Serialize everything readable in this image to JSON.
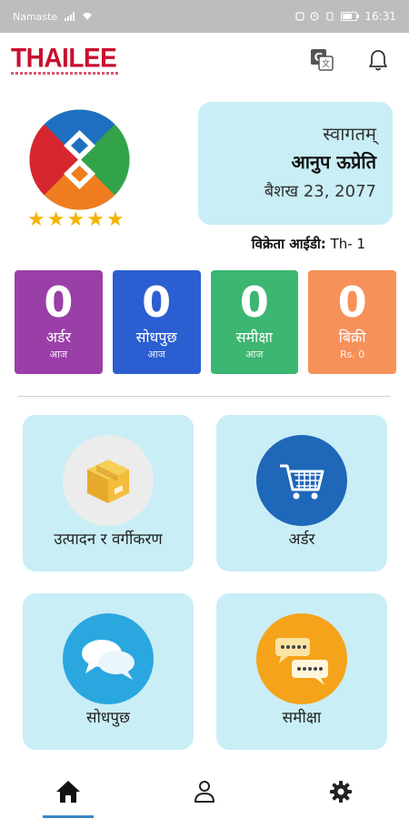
{
  "status_bar": {
    "carrier": "Namaste",
    "time": "16:31"
  },
  "header": {
    "logo_text": "THAILEE",
    "translate_icon": "translate-icon",
    "bell_icon": "bell-icon"
  },
  "profile": {
    "rating": 5
  },
  "welcome": {
    "greeting": "स्वागतम्",
    "name": "आनुप ऊप्रेति",
    "date": "बैशख 23, 2077"
  },
  "seller": {
    "label": "विक्रेता आईडी:",
    "value": "Th- 1"
  },
  "stats": [
    {
      "value": "0",
      "label": "अर्डर",
      "sub": "आज",
      "color": "#9b3fa8"
    },
    {
      "value": "0",
      "label": "सोधपुछ",
      "sub": "आज",
      "color": "#2b5fd1"
    },
    {
      "value": "0",
      "label": "समीक्षा",
      "sub": "आज",
      "color": "#3cb671"
    },
    {
      "value": "0",
      "label": "बिक्री",
      "sub": "Rs. 0",
      "color": "#f6915a"
    }
  ],
  "menu": [
    {
      "label": "उत्पादन र वर्गीकरण",
      "icon": "box-icon"
    },
    {
      "label": "अर्डर",
      "icon": "cart-icon"
    },
    {
      "label": "सोधपुछ",
      "icon": "chat-bubbles-icon"
    },
    {
      "label": "समीक्षा",
      "icon": "review-bubbles-icon"
    }
  ],
  "bottom_nav": {
    "active": "home",
    "items": [
      "home-icon",
      "profile-icon",
      "settings-icon"
    ]
  },
  "colors": {
    "accent": "#3b84c4",
    "card": "#c9eef6",
    "brand": "#c8102e"
  }
}
